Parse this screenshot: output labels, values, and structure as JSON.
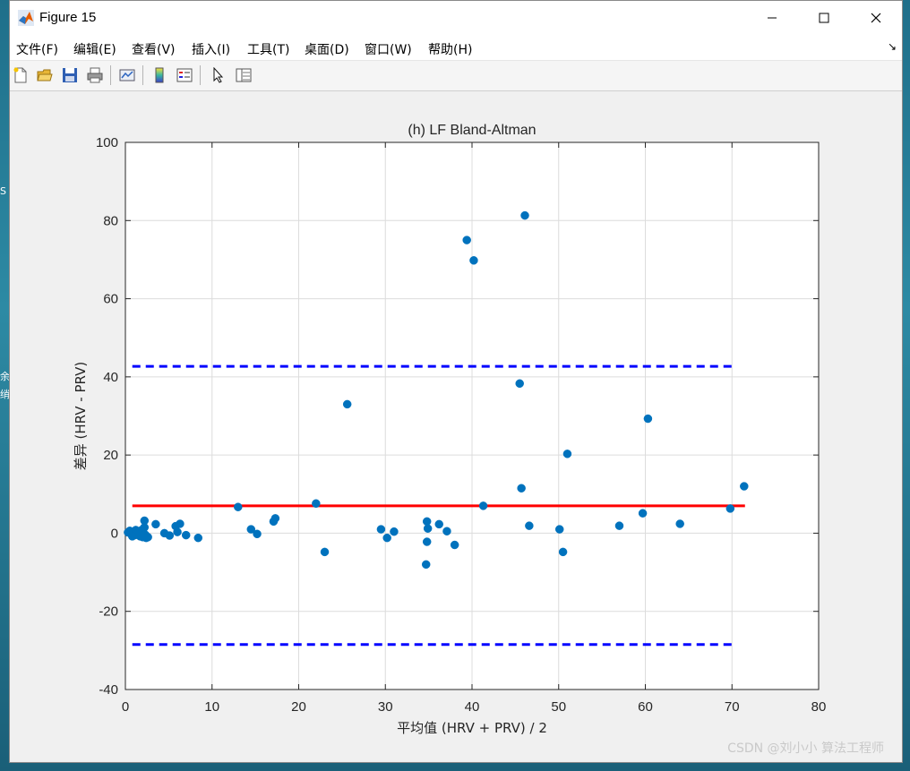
{
  "window": {
    "title": "Figure 15"
  },
  "menu": [
    "文件(F)",
    "编辑(E)",
    "查看(V)",
    "插入(I)",
    "工具(T)",
    "桌面(D)",
    "窗口(W)",
    "帮助(H)"
  ],
  "toolbar": [
    "new-figure-icon",
    "open-file-icon",
    "save-icon",
    "print-icon",
    "link-plot-icon",
    "colorbar-icon",
    "legend-icon",
    "pointer-icon",
    "property-inspector-icon"
  ],
  "desktop_fragments": [
    "S",
    "余",
    "绡"
  ],
  "watermark": "CSDN @刘小小 算法工程师",
  "colors": {
    "points": "#0072BD",
    "mean_line": "#FF0000",
    "limit_lines": "#0000FF",
    "grid": "#dcdcdc"
  },
  "chart_data": {
    "type": "scatter",
    "title": "(h) LF Bland-Altman",
    "xlabel": "平均值 (HRV + PRV) / 2",
    "ylabel": "差异 (HRV - PRV)",
    "xlim": [
      0,
      80
    ],
    "ylim": [
      -40,
      100
    ],
    "xticks": [
      0,
      10,
      20,
      30,
      40,
      50,
      60,
      70,
      80
    ],
    "yticks": [
      -40,
      -20,
      0,
      20,
      40,
      60,
      80,
      100
    ],
    "grid": true,
    "points": [
      [
        0.3,
        0.2
      ],
      [
        0.5,
        0.6
      ],
      [
        0.7,
        -0.3
      ],
      [
        0.9,
        0.4
      ],
      [
        1.0,
        0.1
      ],
      [
        1.1,
        -0.5
      ],
      [
        1.2,
        0.8
      ],
      [
        1.3,
        0.3
      ],
      [
        1.4,
        -0.2
      ],
      [
        1.5,
        0.5
      ],
      [
        1.6,
        0.0
      ],
      [
        1.7,
        -0.8
      ],
      [
        1.8,
        0.7
      ],
      [
        1.9,
        0.2
      ],
      [
        2.0,
        -1.0
      ],
      [
        2.1,
        1.2
      ],
      [
        2.2,
        3.2
      ],
      [
        2.2,
        1.5
      ],
      [
        2.3,
        -0.4
      ],
      [
        2.4,
        -1.2
      ],
      [
        2.6,
        -1.0
      ],
      [
        0.8,
        -0.8
      ],
      [
        3.5,
        2.3
      ],
      [
        4.5,
        0.0
      ],
      [
        5.1,
        -0.6
      ],
      [
        5.8,
        1.8
      ],
      [
        6.0,
        0.3
      ],
      [
        6.3,
        2.4
      ],
      [
        7.0,
        -0.5
      ],
      [
        8.4,
        -1.2
      ],
      [
        13.0,
        6.7
      ],
      [
        14.5,
        1.0
      ],
      [
        15.2,
        -0.2
      ],
      [
        17.1,
        3.0
      ],
      [
        17.3,
        3.8
      ],
      [
        22.0,
        7.6
      ],
      [
        23.0,
        -4.8
      ],
      [
        25.6,
        33.0
      ],
      [
        29.5,
        1.0
      ],
      [
        30.2,
        -1.2
      ],
      [
        31.0,
        0.4
      ],
      [
        34.7,
        -8.0
      ],
      [
        34.8,
        3.0
      ],
      [
        34.8,
        -2.2
      ],
      [
        34.9,
        1.2
      ],
      [
        36.2,
        2.3
      ],
      [
        37.1,
        0.5
      ],
      [
        38.0,
        -3.0
      ],
      [
        39.4,
        75.0
      ],
      [
        40.2,
        69.8
      ],
      [
        41.3,
        7.0
      ],
      [
        45.5,
        38.3
      ],
      [
        45.7,
        11.5
      ],
      [
        46.1,
        81.3
      ],
      [
        46.6,
        1.9
      ],
      [
        50.1,
        1.0
      ],
      [
        50.5,
        -4.8
      ],
      [
        51.0,
        20.3
      ],
      [
        57.0,
        1.9
      ],
      [
        59.7,
        5.1
      ],
      [
        60.3,
        29.3
      ],
      [
        64.0,
        2.4
      ],
      [
        69.8,
        6.3
      ],
      [
        71.4,
        12.0
      ]
    ],
    "mean_difference": 7.0,
    "upper_limit": 42.7,
    "lower_limit": -28.5
  }
}
